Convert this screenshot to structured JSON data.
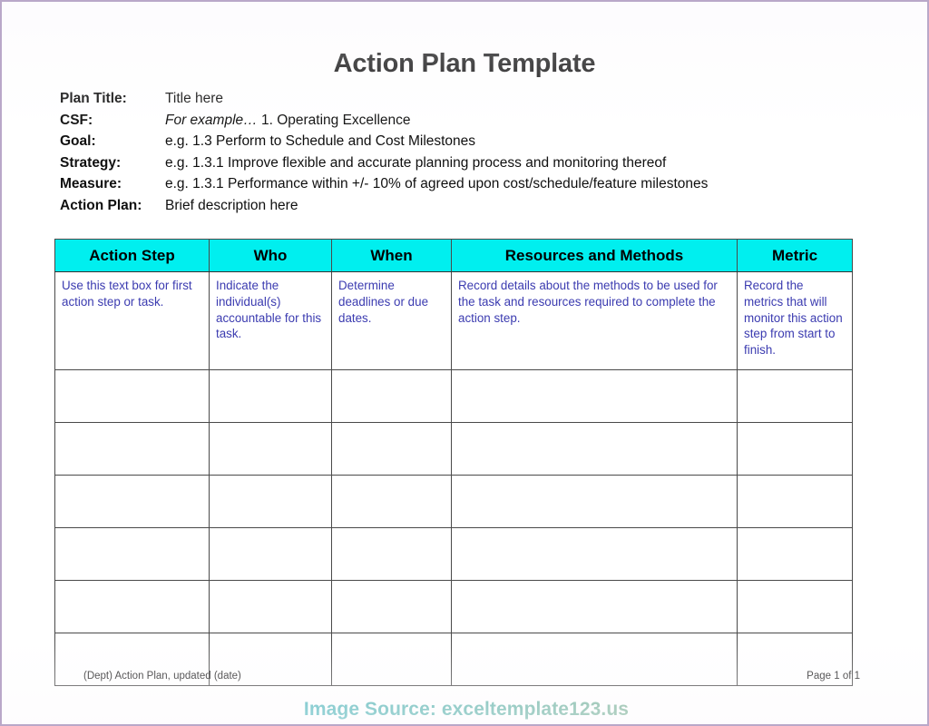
{
  "document": {
    "title": "Action Plan Template"
  },
  "meta": {
    "rows": [
      {
        "label": "Plan Title:",
        "value": "Title here",
        "italic_prefix": ""
      },
      {
        "label": "CSF:",
        "value": "1. Operating Excellence",
        "italic_prefix": "For example…"
      },
      {
        "label": "Goal:",
        "value": "e.g.  1.3  Perform to Schedule and Cost Milestones",
        "italic_prefix": ""
      },
      {
        "label": "Strategy:",
        "value": "e.g.  1.3.1  Improve flexible and accurate planning process and monitoring thereof",
        "italic_prefix": ""
      },
      {
        "label": "Measure:",
        "value": "e.g.  1.3.1  Performance within +/- 10% of agreed upon cost/schedule/feature milestones",
        "italic_prefix": ""
      },
      {
        "label": "Action Plan:",
        "value": "Brief description here",
        "italic_prefix": ""
      }
    ]
  },
  "table": {
    "header_background": "#00efef",
    "body_text_color": "#3b3bb0",
    "columns": [
      "Action Step",
      "Who",
      "When",
      "Resources and Methods",
      "Metric"
    ],
    "rows": [
      {
        "filled": true,
        "cells": [
          "Use this text box for first action step or task.",
          "Indicate the individual(s) accountable for this task.",
          "Determine deadlines or due dates.",
          "Record details about the methods to be used for the task and resources required to complete the action step.",
          "Record the metrics that will monitor this action step from start to finish."
        ]
      },
      {
        "filled": false,
        "cells": [
          "",
          "",
          "",
          "",
          ""
        ]
      },
      {
        "filled": false,
        "cells": [
          "",
          "",
          "",
          "",
          ""
        ]
      },
      {
        "filled": false,
        "cells": [
          "",
          "",
          "",
          "",
          ""
        ]
      },
      {
        "filled": false,
        "cells": [
          "",
          "",
          "",
          "",
          ""
        ]
      },
      {
        "filled": false,
        "cells": [
          "",
          "",
          "",
          "",
          ""
        ]
      },
      {
        "filled": false,
        "cells": [
          "",
          "",
          "",
          "",
          ""
        ]
      }
    ]
  },
  "footer": {
    "left": "(Dept) Action Plan, updated (date)",
    "right": "Page 1 of 1"
  },
  "watermark": {
    "text": "Image Source: exceltemplate123.us"
  }
}
